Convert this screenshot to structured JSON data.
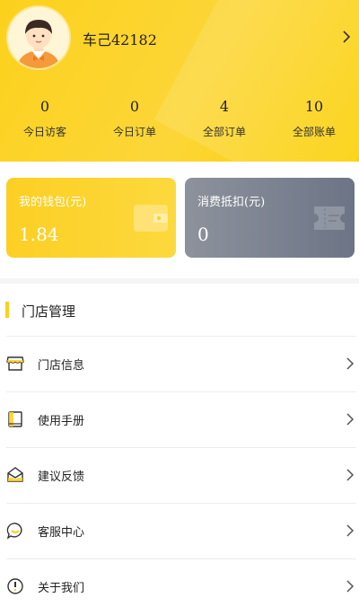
{
  "profile": {
    "username": "车己42182"
  },
  "stats": [
    {
      "value": "0",
      "label": "今日访客"
    },
    {
      "value": "0",
      "label": "今日订单"
    },
    {
      "value": "4",
      "label": "全部订单"
    },
    {
      "value": "10",
      "label": "全部账单"
    }
  ],
  "cards": {
    "wallet": {
      "title": "我的钱包(元)",
      "value": "1.84"
    },
    "deduct": {
      "title": "消费抵扣(元)",
      "value": "0"
    }
  },
  "section": {
    "title": "门店管理"
  },
  "menu": [
    {
      "label": "门店信息",
      "icon": "store-icon"
    },
    {
      "label": "使用手册",
      "icon": "book-icon"
    },
    {
      "label": "建议反馈",
      "icon": "feedback-inbox-icon"
    },
    {
      "label": "客服中心",
      "icon": "chat-bubble-icon"
    },
    {
      "label": "关于我们",
      "icon": "info-icon"
    }
  ],
  "colors": {
    "accent": "#fcd11c",
    "header_bg": "#fcd638",
    "gray_card": "#7a808e",
    "icon_dark": "#333333"
  }
}
